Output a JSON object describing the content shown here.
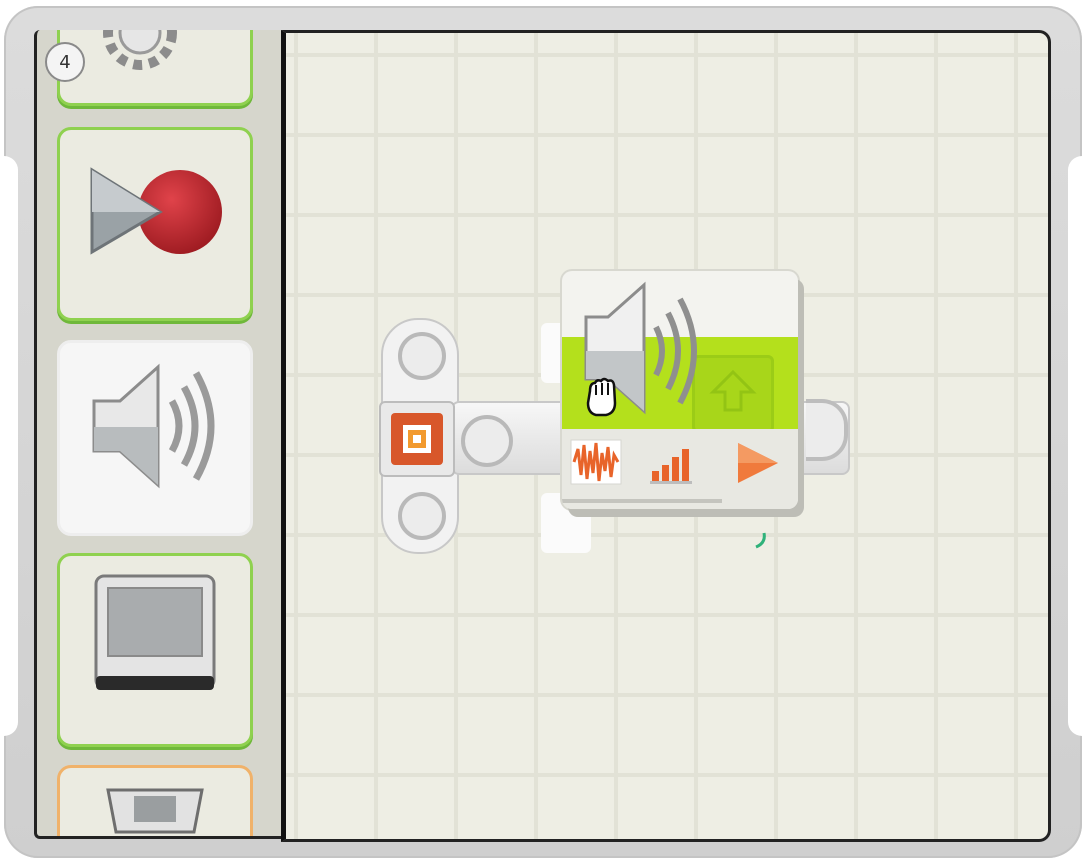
{
  "palette": {
    "badge_number": "4",
    "tiles": [
      {
        "name": "gear-block",
        "icon": "gear-icon"
      },
      {
        "name": "record-play-block",
        "icon": "record-play-icon"
      },
      {
        "name": "sound-block",
        "icon": "speaker-icon",
        "selected": true
      },
      {
        "name": "display-block",
        "icon": "display-icon"
      },
      {
        "name": "send-message-block",
        "icon": "nxt-icon"
      }
    ]
  },
  "canvas": {
    "dragged_block": "sound",
    "sound_block_icons": [
      "speaker-icon",
      "waveform-icon",
      "volume-bars-icon",
      "play-icon"
    ],
    "cursor": "grab-hand-cursor"
  },
  "colors": {
    "accent_green": "#b4e01c",
    "palette_border_green": "#8fd14f",
    "icon_orange": "#e8642a",
    "record_red": "#c8262e"
  }
}
